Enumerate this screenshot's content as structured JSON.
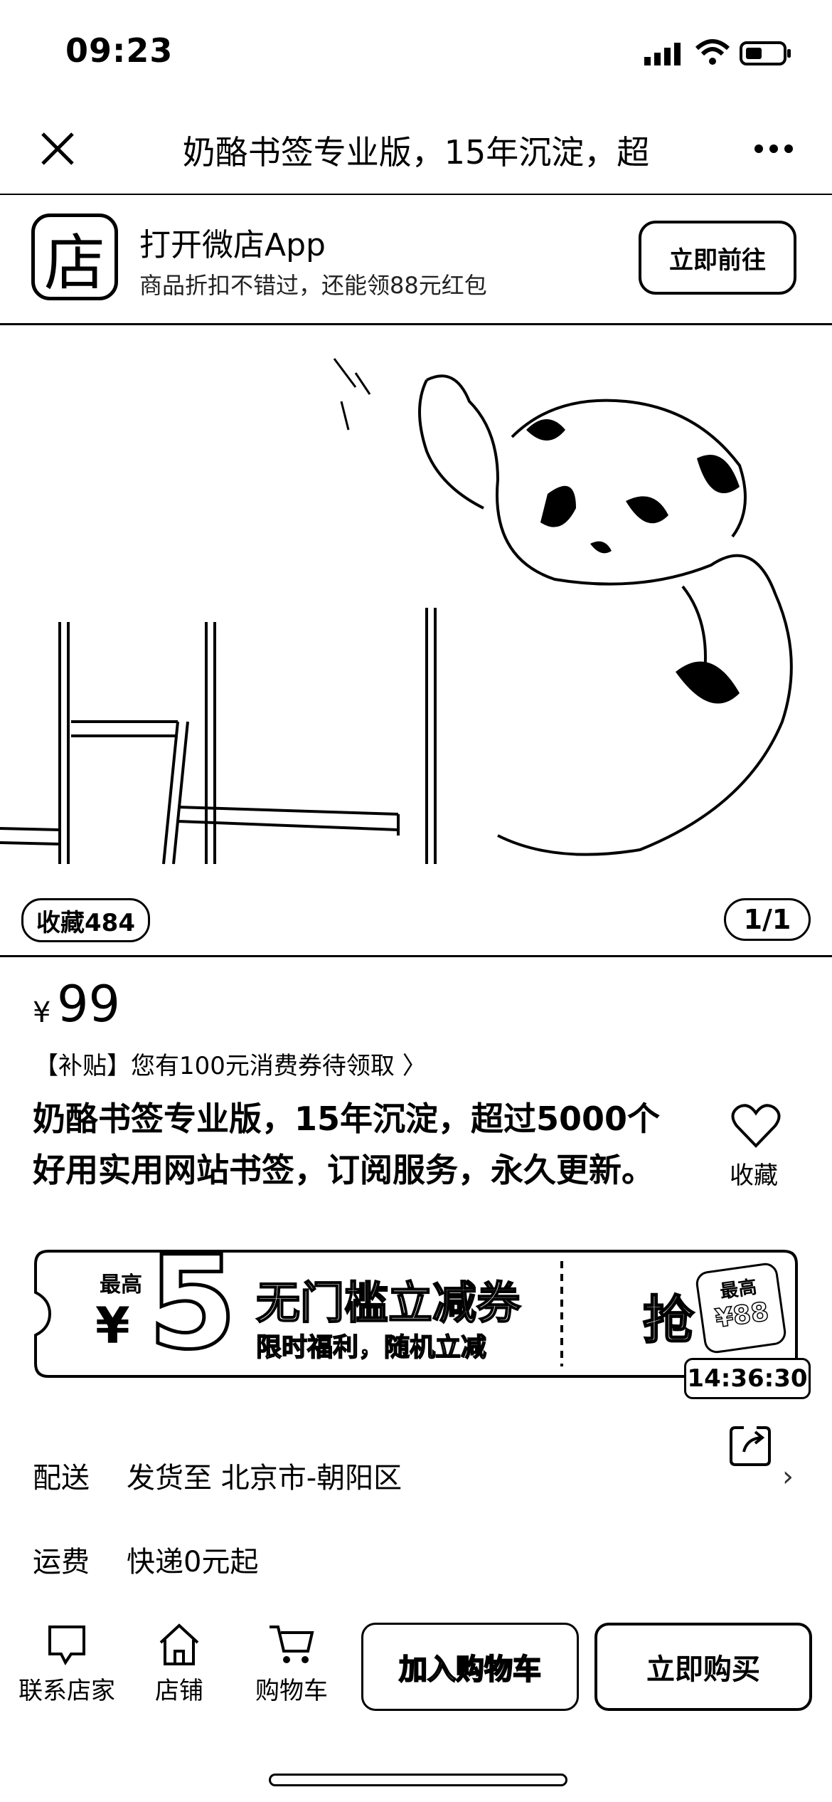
{
  "status_bar": {
    "time": "09:23"
  },
  "nav": {
    "title": "奶酪书签专业版，15年沉淀，超"
  },
  "app_banner": {
    "logo_char": "店",
    "title": "打开微店App",
    "subtitle": "商品折扣不错过，还能领88元红包",
    "button": "立即前往"
  },
  "gallery": {
    "favorites": "收藏484",
    "page": "1/1"
  },
  "price": {
    "currency": "¥",
    "value": "99"
  },
  "subsidy": "【补贴】您有100元消费券待领取 〉",
  "product": {
    "title_line1": "奶酪书签专业版，15年沉淀，超过5000个",
    "title_line2": "好用实用网站书签，订阅服务，永久更新。",
    "favorite_label": "收藏"
  },
  "coupon": {
    "max_label": "最高",
    "currency": "¥",
    "amount": "5",
    "title": "无门槛立减券",
    "subtitle": "限时福利，随机立减",
    "grab": "抢",
    "tag_max": "最高",
    "tag_amount": "¥88",
    "timer": "14:36:30"
  },
  "delivery": {
    "label": "配送",
    "value": "发货至  北京市-朝阳区",
    "chevron": "›"
  },
  "shipping": {
    "label": "运费",
    "value": "快递0元起"
  },
  "bottom_bar": {
    "tabs": [
      {
        "label": "联系店家",
        "icon": "chat-icon"
      },
      {
        "label": "店铺",
        "icon": "home-icon"
      },
      {
        "label": "购物车",
        "icon": "cart-icon"
      }
    ],
    "add_to_cart": "加入购物车",
    "buy_now": "立即购买"
  }
}
